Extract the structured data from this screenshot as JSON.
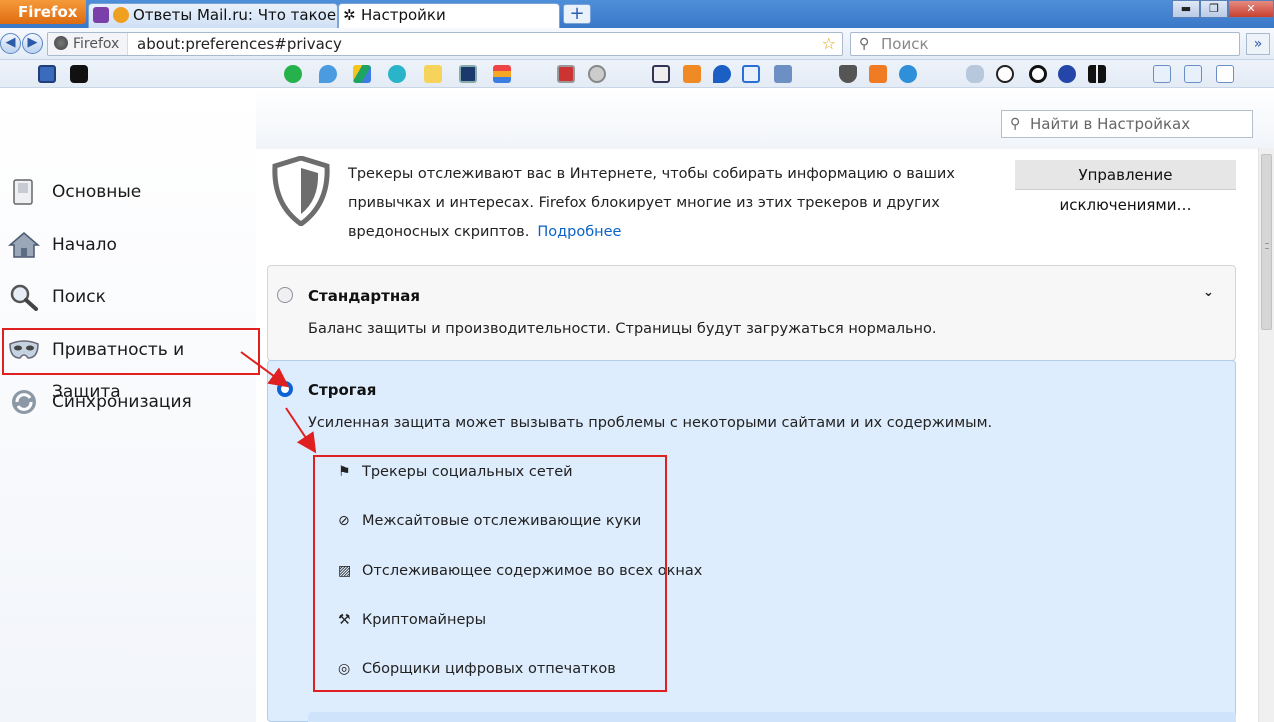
{
  "browser": {
    "menu_label": "Firefox",
    "tabs": [
      {
        "label": "Ответы Mail.ru: Что такое"
      },
      {
        "label": "Настройки"
      }
    ],
    "new_tab": "+",
    "window_buttons": {
      "minimize": "▬",
      "restore": "❐",
      "close": "✕"
    },
    "identity_label": "Firefox",
    "url": "about:preferences#privacy",
    "search_placeholder": "Поиск",
    "overflow": "»"
  },
  "sidebar": {
    "items": [
      {
        "label": "Основные"
      },
      {
        "label": "Начало"
      },
      {
        "label": "Поиск"
      },
      {
        "label": "Приватность и Защита"
      },
      {
        "label": "Синхронизация"
      }
    ]
  },
  "find_placeholder": "Найти в Настройках",
  "tracking": {
    "description": "Трекеры отслеживают вас в Интернете, чтобы собирать информацию о ваших привычках и интересах. Firefox блокирует многие из этих трекеров и других вредоносных скриптов.",
    "learn_more": "Подробнее",
    "manage_exceptions": "Управление исключениями…"
  },
  "standard": {
    "title": "Стандартная",
    "description": "Баланс защиты и производительности. Страницы будут загружаться нормально."
  },
  "strict": {
    "title": "Строгая",
    "description": "Усиленная защита может вызывать проблемы с некоторыми сайтами и их содержимым.",
    "features": [
      {
        "label": "Трекеры социальных сетей"
      },
      {
        "label": "Межсайтовые отслеживающие куки"
      },
      {
        "label": "Отслеживающее содержимое во всех окнах"
      },
      {
        "label": "Криптомайнеры"
      },
      {
        "label": "Сборщики цифровых отпечатков"
      }
    ]
  },
  "colors": {
    "annotation": "#e02020",
    "strict_bg": "#deedfd",
    "link": "#0a62c8",
    "radio": "#0a62d6"
  }
}
